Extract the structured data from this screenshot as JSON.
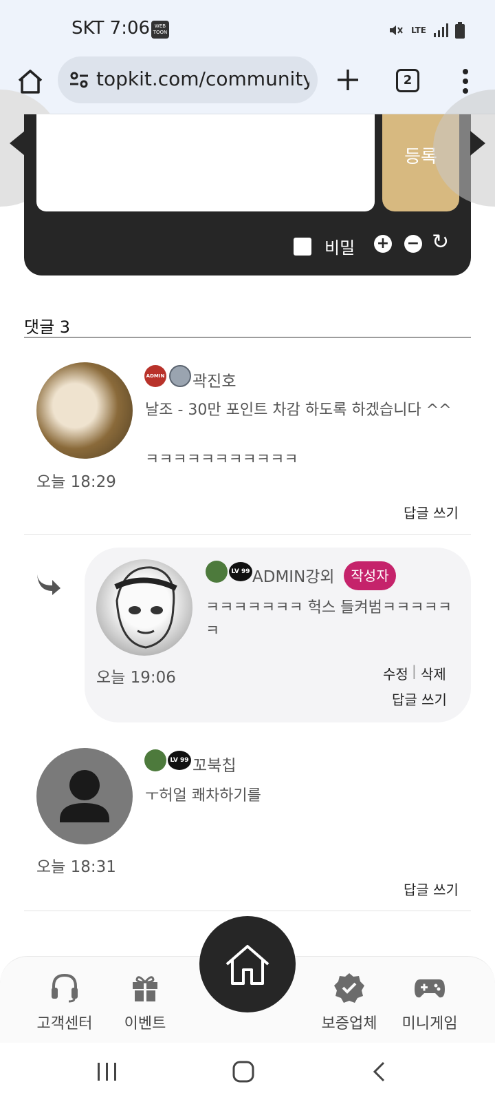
{
  "status_bar": {
    "carrier_time": "SKT 7:06",
    "webtoon_badge": "WEB TOON",
    "network": "LTE"
  },
  "browser": {
    "url": "topkit.com/community/",
    "tab_count": "2"
  },
  "comment_form": {
    "submit_label": "등록",
    "secret_label": "비밀",
    "plus_label": "+",
    "minus_label": "−",
    "refresh_label": "↻"
  },
  "comments_header": {
    "title": "댓글 3"
  },
  "comments": [
    {
      "author": "곽진호",
      "badge": "ADMIN",
      "text_line1": "날조 - 30만 포인트 차감 하도록 하겠습니다 ^^",
      "text_line2": "ㅋㅋㅋㅋㅋㅋㅋㅋㅋㅋㅋ",
      "time": "오늘 18:29",
      "reply_label": "답글 쓰기"
    },
    {
      "author": "ADMIN강외",
      "level_badge": "LV 99",
      "author_tag": "작성자",
      "text_line1": "ㅋㅋㅋㅋㅋㅋㅋ 헉스 들켜범ㅋㅋㅋㅋㅋ",
      "text_line2": "ㅋ",
      "time": "오늘 19:06",
      "edit_label": "수정",
      "separator": "|",
      "delete_label": "삭제",
      "reply_label": "답글 쓰기"
    },
    {
      "author": "꼬북칩",
      "level_badge": "LV 99",
      "text_line1": "ㅜ허얼 쾌차하기를",
      "time": "오늘 18:31",
      "reply_label": "답글 쓰기"
    }
  ],
  "bottom_nav": {
    "items": [
      {
        "label": "고객센터",
        "icon": "headset-icon"
      },
      {
        "label": "이벤트",
        "icon": "gift-icon"
      },
      {
        "label": "보증업체",
        "icon": "verified-badge-icon"
      },
      {
        "label": "미니게임",
        "icon": "gamepad-icon"
      }
    ],
    "home_icon": "home-icon"
  },
  "colors": {
    "dark_panel": "#262626",
    "submit_gold": "#d7b980",
    "author_tag": "#c5236b",
    "chrome_bg": "#eef3fb"
  }
}
